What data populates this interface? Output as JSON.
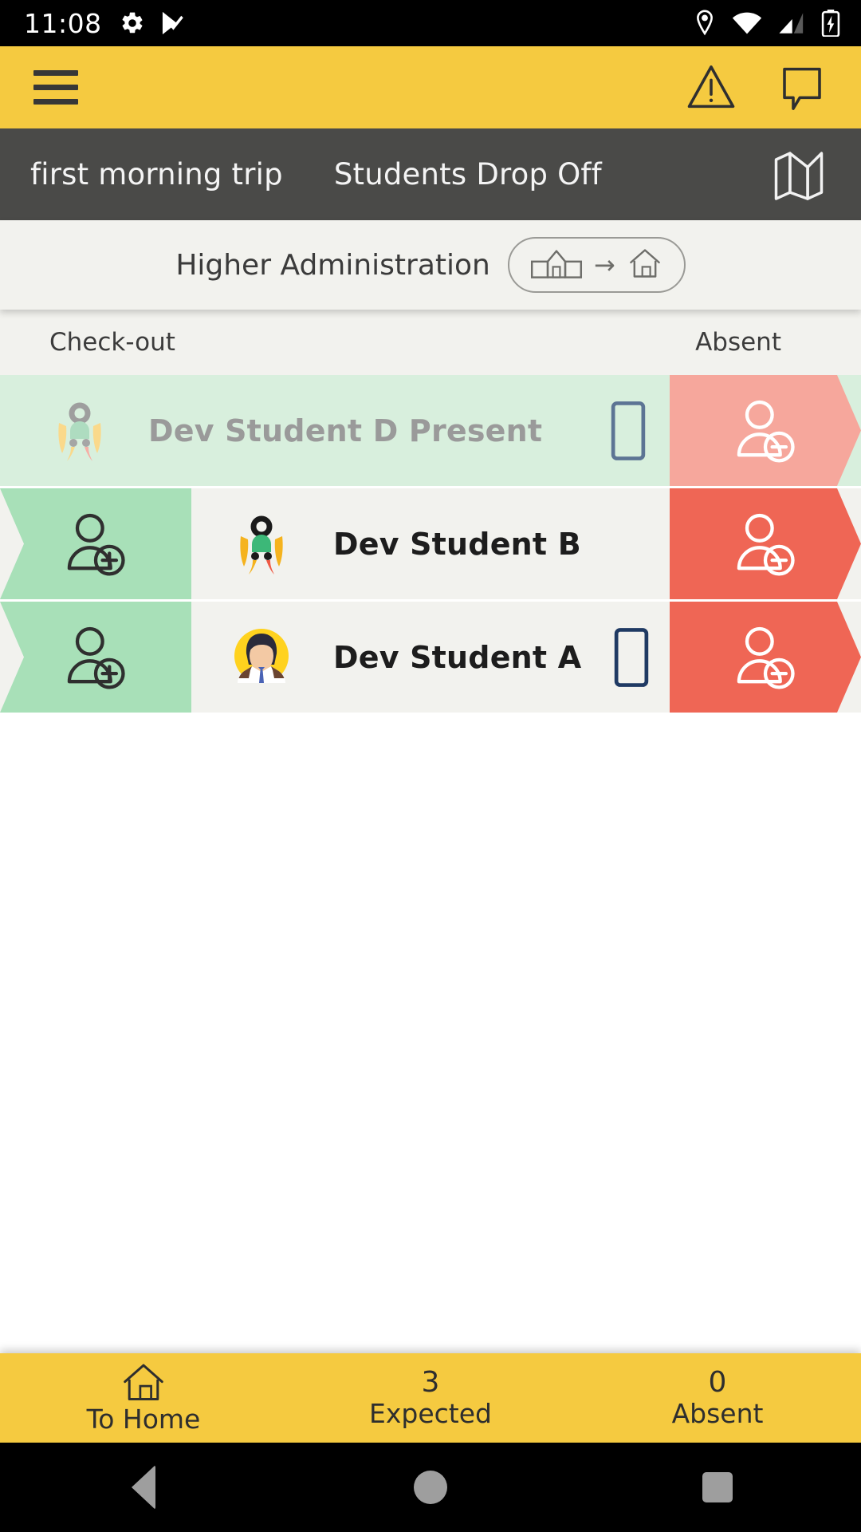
{
  "status_bar": {
    "time": "11:08",
    "left_icons": [
      "gear-icon",
      "play-check-icon"
    ],
    "right_icons": [
      "location-pin-icon",
      "wifi-icon",
      "cellular-signal-icon",
      "battery-charging-icon"
    ]
  },
  "app_bar": {
    "menu_icon": "hamburger-menu-icon",
    "warning_icon": "warning-triangle-icon",
    "chat_icon": "chat-bubble-icon",
    "background": "#F5CA40"
  },
  "trip_bar": {
    "trip_name": "first morning trip",
    "trip_type": "Students Drop Off",
    "map_icon": "folded-map-icon",
    "background": "#4A4A48"
  },
  "subheader": {
    "title": "Higher Administration",
    "direction_from_icon": "school-building-icon",
    "direction_arrow": "→",
    "direction_to_icon": "home-icon"
  },
  "list_header": {
    "left_label": "Check-out",
    "right_label": "Absent"
  },
  "students": [
    {
      "name": "Dev Student D Present",
      "avatar": "abstract-figure-avatar-faded",
      "present": true,
      "has_phone": true,
      "checkout_visible": false,
      "checkout_icon": "person-add-icon",
      "absent_icon": "person-remove-icon",
      "row_background": "#D8EFDD",
      "absent_color": "#F6A79C"
    },
    {
      "name": "Dev Student B",
      "avatar": "abstract-figure-avatar",
      "present": false,
      "has_phone": false,
      "checkout_visible": true,
      "checkout_icon": "person-add-icon",
      "absent_icon": "person-remove-icon",
      "row_background": "#F2F2EE",
      "absent_color": "#EF6655"
    },
    {
      "name": "Dev Student A",
      "avatar": "photo-person-avatar",
      "present": false,
      "has_phone": true,
      "checkout_visible": true,
      "checkout_icon": "person-add-icon",
      "absent_icon": "person-remove-icon",
      "row_background": "#F2F2EE",
      "absent_color": "#EF6655"
    }
  ],
  "bottom_bar": {
    "home_label": "To Home",
    "home_icon": "home-icon",
    "expected_count": "3",
    "expected_label": "Expected",
    "absent_count": "0",
    "absent_label": "Absent",
    "background": "#F5CA40"
  },
  "nav_bar": {
    "back_icon": "triangle-back-icon",
    "home_icon": "circle-home-icon",
    "recents_icon": "square-recents-icon"
  },
  "colors": {
    "accent_yellow": "#F5CA40",
    "dark_bar": "#4A4A48",
    "present_green": "#D8EFDD",
    "checkout_green": "#A8E0B8",
    "absent_red": "#EF6655",
    "absent_red_faded": "#F6A79C",
    "row_bg": "#F2F2EE",
    "phone_navy": "#1F3A63"
  }
}
